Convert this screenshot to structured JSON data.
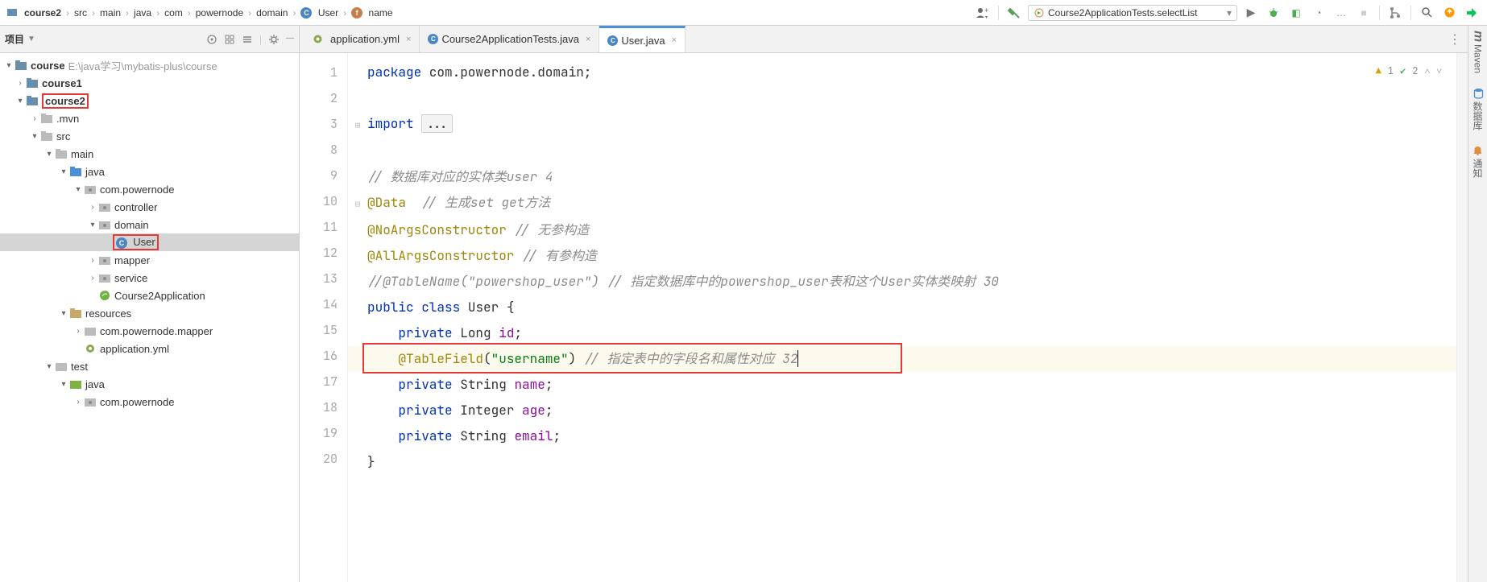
{
  "breadcrumb": {
    "items": [
      "course2",
      "src",
      "main",
      "java",
      "com",
      "powernode",
      "domain"
    ],
    "class": "User",
    "field": "name"
  },
  "run_config": "Course2ApplicationTests.selectList",
  "project_header": {
    "title": "项目"
  },
  "tree": {
    "root": "course",
    "root_path": "E:\\java学习\\mybatis-plus\\course",
    "course1": "course1",
    "course2": "course2",
    "mvn": ".mvn",
    "src": "src",
    "main": "main",
    "java": "java",
    "pkg": "com.powernode",
    "controller": "controller",
    "domain": "domain",
    "user": "User",
    "mapper": "mapper",
    "service": "service",
    "app": "Course2Application",
    "resources": "resources",
    "res_mapper": "com.powernode.mapper",
    "app_yml": "application.yml",
    "test": "test",
    "test_java": "java",
    "test_pkg": "com.powernode"
  },
  "tabs": {
    "t1": "application.yml",
    "t2": "Course2ApplicationTests.java",
    "t3": "User.java"
  },
  "inspection": {
    "warn": "1",
    "pass": "2"
  },
  "code": {
    "l1a": "package",
    "l1b": " com.powernode.domain;",
    "l3a": "import",
    "l3b": "...",
    "l9": " 数据库对应的实体类user   4",
    "l10a": "@Data",
    "l10b": " 生成set get方法",
    "l11a": "@NoArgsConstructor",
    "l11b": " 无参构造",
    "l12a": "@AllArgsConstructor",
    "l12b": " 有参构造",
    "l13a": "@TableName(\"powershop_user\")",
    "l13b": " 指定数据库中的powershop_user表和这个User实体类映射  30",
    "l14a": "public",
    "l14b": "class",
    "l14c": "User {",
    "l15a": "private",
    "l15b": "Long",
    "l15c": "id",
    "l16a": "@TableField",
    "l16b": "\"username\"",
    "l16c": " 指定表中的字段名和属性对应  32",
    "l17a": "private",
    "l17b": "String",
    "l17c": "name",
    "l18a": "private",
    "l18b": "Integer",
    "l18c": "age",
    "l19a": "private",
    "l19b": "String",
    "l19c": "email",
    "l20": "}"
  },
  "gutter": [
    "1",
    "2",
    "3",
    "8",
    "9",
    "10",
    "11",
    "12",
    "13",
    "14",
    "15",
    "16",
    "17",
    "18",
    "19",
    "20"
  ],
  "right_tools": {
    "maven": "Maven",
    "db": "数据库",
    "notify": "通知"
  }
}
